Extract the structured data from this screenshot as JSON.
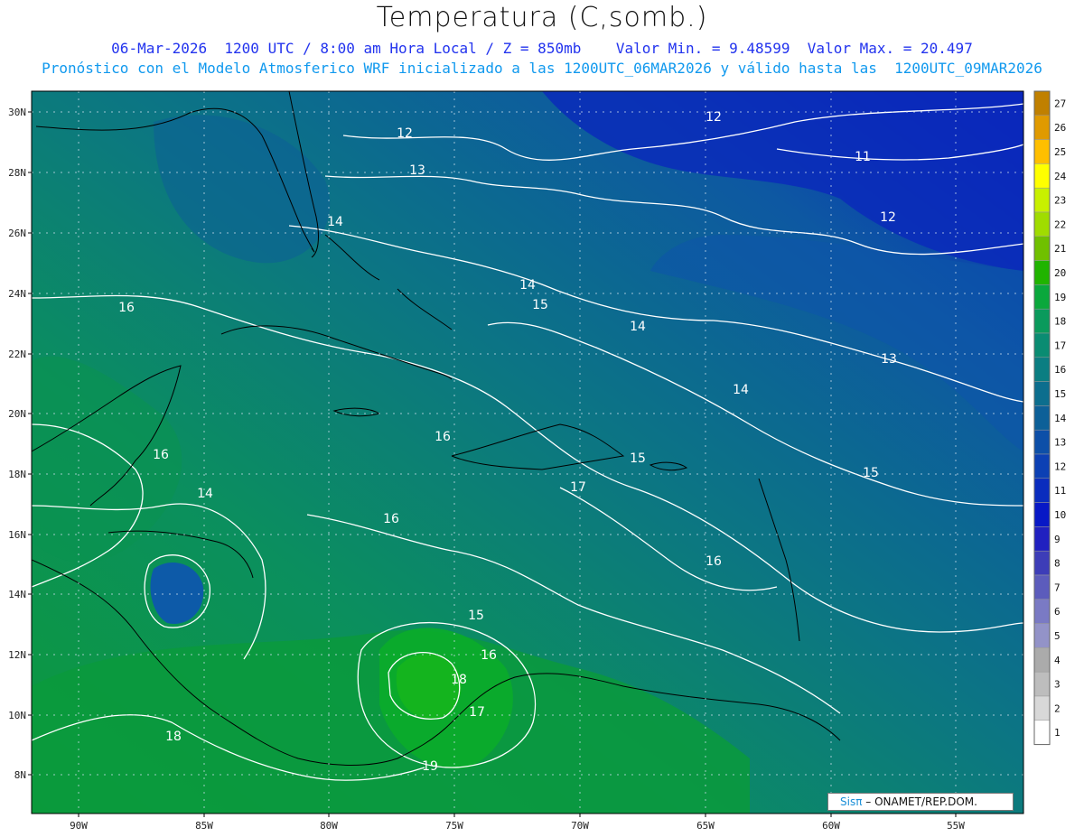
{
  "header": {
    "title": "Temperatura (C,somb.)",
    "line1": "06-Mar-2026  1200 UTC / 8:00 am Hora Local / Z = 850mb    Valor Min. = 9.48599  Valor Max. = 20.497",
    "line2": "Pronóstico con el Modelo Atmosferico WRF inicializado a las 1200UTC_06MAR2026 y válido hasta las  1200UTC_09MAR2026"
  },
  "map": {
    "lon_ticks": [
      "90W",
      "85W",
      "80W",
      "75W",
      "70W",
      "65W",
      "60W",
      "55W"
    ],
    "lat_ticks": [
      "30N",
      "28N",
      "26N",
      "24N",
      "22N",
      "20N",
      "18N",
      "16N",
      "14N",
      "12N",
      "10N",
      "8N"
    ],
    "contour_labels": [
      "12",
      "12",
      "11",
      "13",
      "14",
      "12",
      "14",
      "15",
      "14",
      "16",
      "13",
      "14",
      "16",
      "16",
      "15",
      "17",
      "15",
      "14",
      "16",
      "16",
      "15",
      "16",
      "17",
      "19",
      "18",
      "18"
    ],
    "value_range": {
      "min": 9.48599,
      "max": 20.497
    }
  },
  "colorbar": {
    "labels": [
      "27",
      "26",
      "25",
      "24",
      "23",
      "22",
      "21",
      "20",
      "19",
      "18",
      "17",
      "16",
      "15",
      "14",
      "13",
      "12",
      "11",
      "10",
      "9",
      "8",
      "7",
      "6",
      "5",
      "4",
      "3",
      "2",
      "1"
    ],
    "colors": [
      "#c08000",
      "#e09a00",
      "#ffbf00",
      "#ffff00",
      "#c8f000",
      "#a0dc00",
      "#70c000",
      "#20b400",
      "#0aa83c",
      "#0a9a5c",
      "#0a8c72",
      "#0b7e82",
      "#0c6e8e",
      "#0d6098",
      "#0d4fa8",
      "#0c40b4",
      "#0a2cbe",
      "#0818c6",
      "#2020c0",
      "#3d3db8",
      "#5c5cbc",
      "#7a7ac4",
      "#9393c8",
      "#ababab",
      "#bdbdbd",
      "#d8d8d8",
      "#ffffff"
    ]
  },
  "credit": {
    "logo": "Sisπ",
    "text": " – ONAMET/REP.DOM."
  }
}
